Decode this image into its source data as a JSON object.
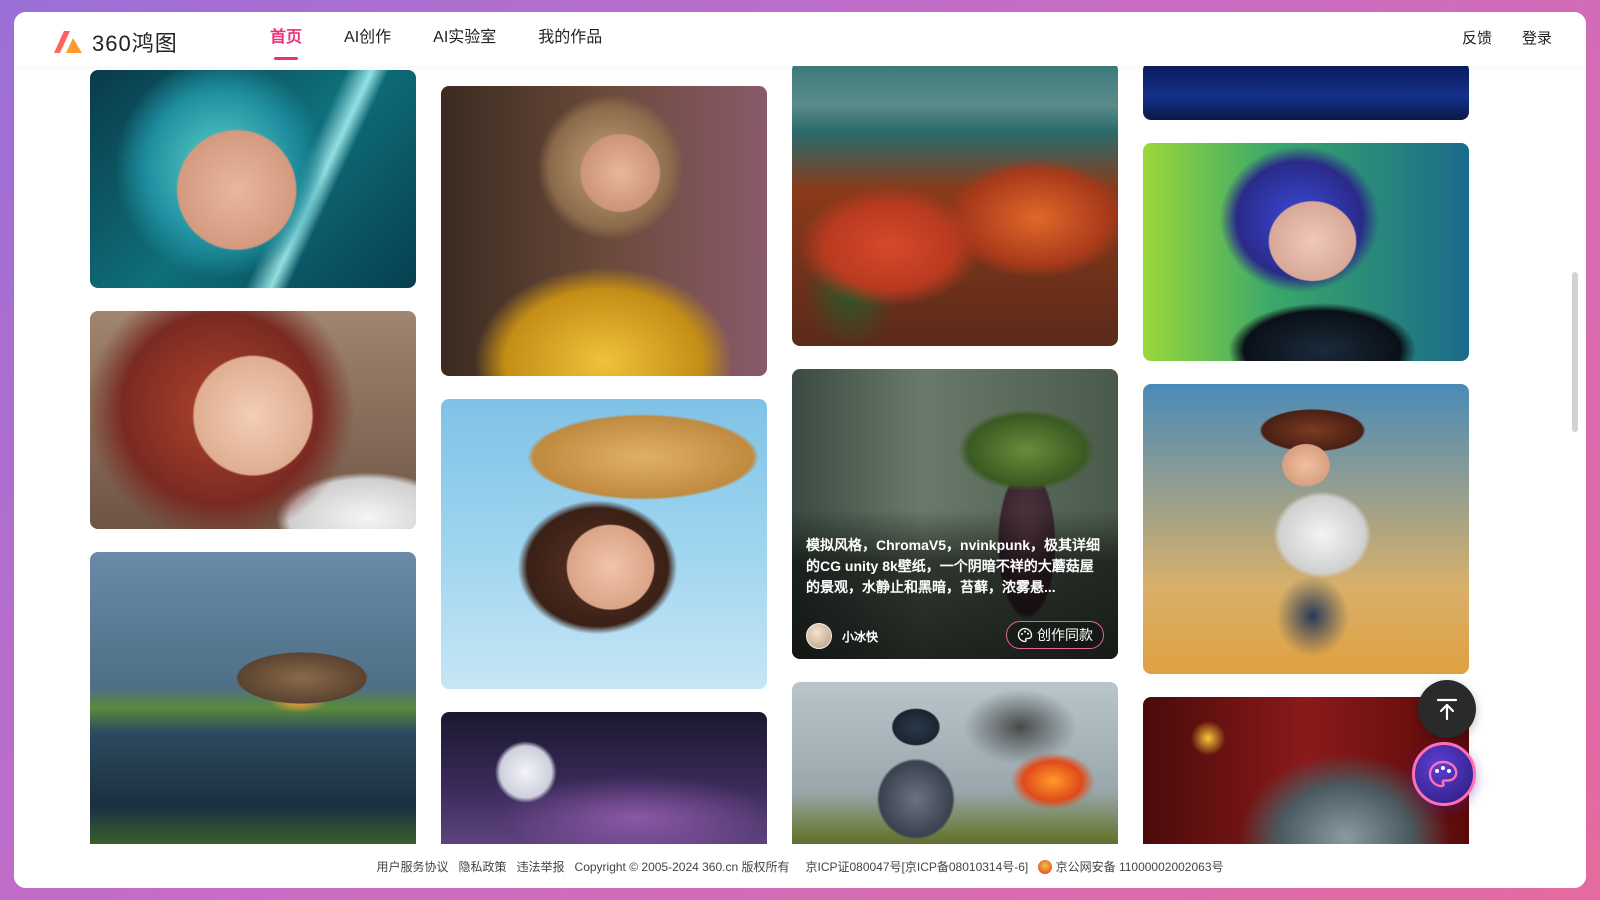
{
  "brand": {
    "name": "360鸿图",
    "logo_icon": "logo-mark"
  },
  "nav": {
    "items": [
      {
        "label": "首页",
        "active": true
      },
      {
        "label": "AI创作",
        "active": false
      },
      {
        "label": "AI实验室",
        "active": false
      },
      {
        "label": "我的作品",
        "active": false
      }
    ]
  },
  "header_right": {
    "feedback": "反馈",
    "login": "登录"
  },
  "gallery": {
    "cards": [
      {
        "id": "c1",
        "subject": "anime girl with teal hair and light streaks"
      },
      {
        "id": "c2",
        "subject": "girl with red hair and fur collar"
      },
      {
        "id": "c3",
        "subject": "thatched hut reflected in misty pond"
      },
      {
        "id": "c4",
        "subject": "woman in golden dress with earrings"
      },
      {
        "id": "c5",
        "subject": "girl in straw cowboy hat under blue sky"
      },
      {
        "id": "c6",
        "subject": "moon over starry purple night sky"
      },
      {
        "id": "c7",
        "subject": "autumn forest valley with river"
      },
      {
        "id": "c8",
        "subject": "giant mushroom house in foggy forest"
      },
      {
        "id": "c9",
        "subject": "astronaut soldier near burning wreck"
      },
      {
        "id": "c10",
        "subject": "deep blue night sky"
      },
      {
        "id": "c11",
        "subject": "anime girl with blue hair and starred jacket"
      },
      {
        "id": "c12",
        "subject": "cowgirl in white blouse at sunset"
      },
      {
        "id": "c13",
        "subject": "metallic sphere on red background"
      }
    ],
    "hover_card": {
      "description": "模拟风格，ChromaV5，nvinkpunk，极其详细的CG unity 8k壁纸，一个阴暗不祥的大蘑菇屋的景观，水静止和黑暗，苔藓，浓雾悬...",
      "username": "小冰快",
      "create_button": "创作同款"
    }
  },
  "footer": {
    "links": [
      "用户服务协议",
      "隐私政策",
      "违法举报"
    ],
    "copyright": "Copyright © 2005-2024 360.cn 版权所有",
    "icp": "京ICP证080047号[京ICP备08010314号-6]",
    "police": "京公网安备 11000002002063号"
  },
  "colors": {
    "accent": "#ec2f7c",
    "text": "#222222"
  },
  "icons": {
    "back_to_top": "arrow-up-icon",
    "ai_assistant": "palette-icon"
  }
}
